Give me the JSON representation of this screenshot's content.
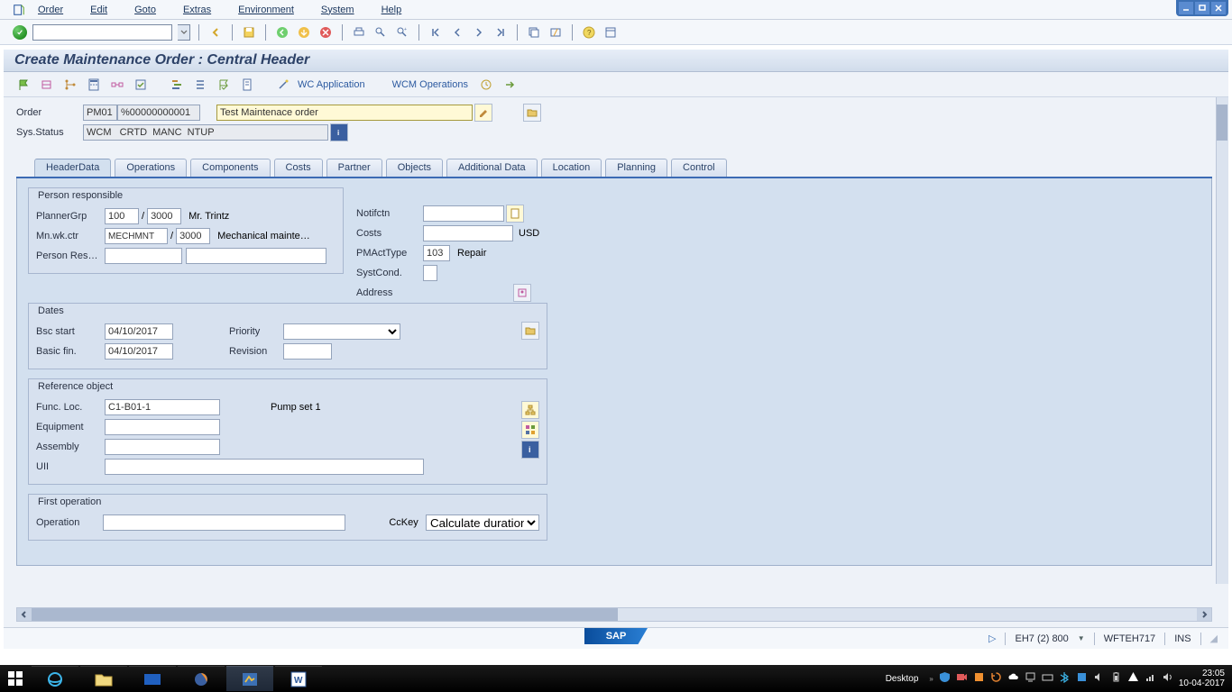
{
  "menu": {
    "items": [
      "Order",
      "Edit",
      "Goto",
      "Extras",
      "Environment",
      "System",
      "Help"
    ]
  },
  "title": "Create Maintenance Order : Central Header",
  "app_toolbar": {
    "wc_app": "WC Application",
    "wcm_ops": "WCM Operations"
  },
  "header": {
    "order_label": "Order",
    "order_type": "PM01",
    "order_num": "%00000000001",
    "order_desc": "Test Maintenace order",
    "sys_status_label": "Sys.Status",
    "sys_status": "WCM   CRTD  MANC  NTUP"
  },
  "tabs": [
    "HeaderData",
    "Operations",
    "Components",
    "Costs",
    "Partner",
    "Objects",
    "Additional Data",
    "Location",
    "Planning",
    "Control"
  ],
  "person_resp": {
    "title": "Person responsible",
    "plannergrp_lbl": "PlannerGrp",
    "plannergrp_1": "100",
    "plannergrp_2": "3000",
    "plannername": "Mr. Trintz",
    "mnwkctr_lbl": "Mn.wk.ctr",
    "mnwkctr_1": "MECHMNT",
    "mnwkctr_2": "3000",
    "mnwkctr_desc": "Mechanical mainte…",
    "personres_lbl": "Person Res…"
  },
  "right_block": {
    "notif_lbl": "Notifctn",
    "costs_lbl": "Costs",
    "costs_cur": "USD",
    "pmact_lbl": "PMActType",
    "pmact_val": "103",
    "pmact_desc": "Repair",
    "systcond_lbl": "SystCond.",
    "address_lbl": "Address"
  },
  "dates": {
    "title": "Dates",
    "bscstart_lbl": "Bsc start",
    "bscstart": "04/10/2017",
    "basicfin_lbl": "Basic fin.",
    "basicfin": "04/10/2017",
    "priority_lbl": "Priority",
    "revision_lbl": "Revision"
  },
  "refobj": {
    "title": "Reference object",
    "funcloc_lbl": "Func. Loc.",
    "funcloc": "C1-B01-1",
    "funcloc_desc": "Pump set 1",
    "equipment_lbl": "Equipment",
    "assembly_lbl": "Assembly",
    "uii_lbl": "UII"
  },
  "firstop": {
    "title": "First operation",
    "operation_lbl": "Operation",
    "cckey_lbl": "CcKey",
    "cckey_val": "Calculate duration"
  },
  "statusbar": {
    "sys": "EH7 (2) 800",
    "host": "WFTEH717",
    "ins": "INS"
  },
  "taskbar": {
    "desktop": "Desktop",
    "time": "23:05",
    "date": "10-04-2017"
  }
}
